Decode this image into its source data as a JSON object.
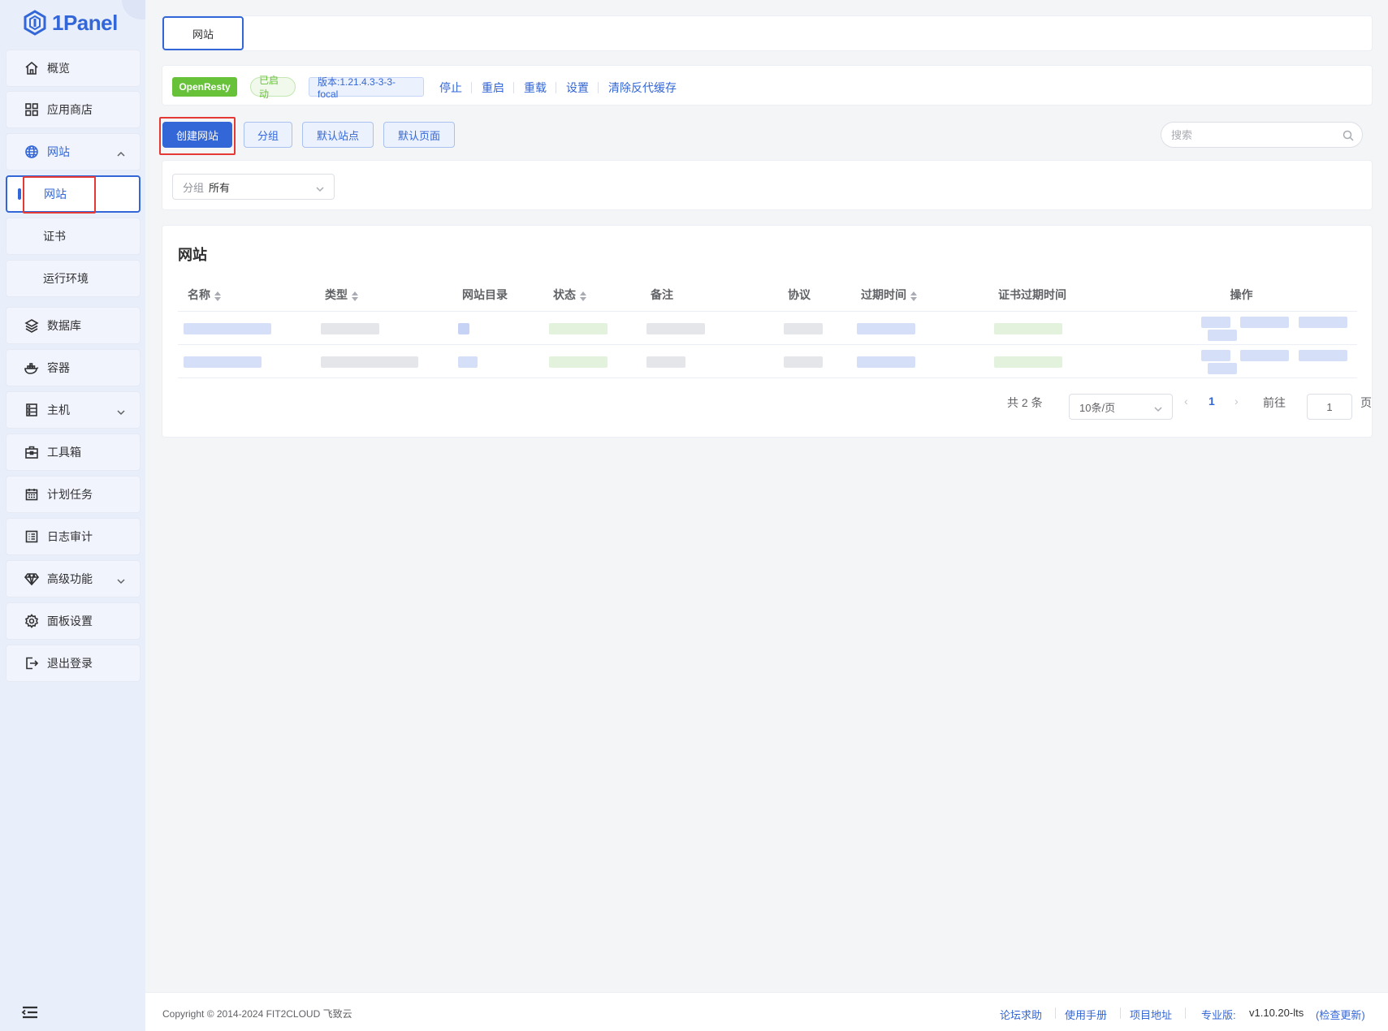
{
  "app": {
    "logo_text": "1Panel"
  },
  "sidebar": {
    "items": [
      {
        "label": "概览",
        "icon": "home-icon"
      },
      {
        "label": "应用商店",
        "icon": "grid-icon"
      },
      {
        "label": "网站",
        "icon": "globe-icon"
      },
      {
        "label": "网站"
      },
      {
        "label": "证书"
      },
      {
        "label": "运行环境"
      },
      {
        "label": "数据库",
        "icon": "layers-icon"
      },
      {
        "label": "容器",
        "icon": "docker-icon"
      },
      {
        "label": "主机",
        "icon": "server-icon"
      },
      {
        "label": "工具箱",
        "icon": "toolbox-icon"
      },
      {
        "label": "计划任务",
        "icon": "calendar-icon"
      },
      {
        "label": "日志审计",
        "icon": "list-icon"
      },
      {
        "label": "高级功能",
        "icon": "diamond-icon"
      },
      {
        "label": "面板设置",
        "icon": "gear-icon"
      },
      {
        "label": "退出登录",
        "icon": "logout-icon"
      }
    ]
  },
  "header": {
    "tab_label": "网站"
  },
  "status_bar": {
    "app_name": "OpenResty",
    "status": "已启动",
    "version": "版本:1.21.4.3-3-3-focal",
    "actions": [
      "停止",
      "重启",
      "重载",
      "设置",
      "清除反代缓存"
    ]
  },
  "toolbar": {
    "create_label": "创建网站",
    "group_label": "分组",
    "default_site_label": "默认站点",
    "default_page_label": "默认页面",
    "search_placeholder": "搜索"
  },
  "filter": {
    "prefix": "分组",
    "value": "所有"
  },
  "table": {
    "title": "网站",
    "columns": [
      "名称",
      "类型",
      "网站目录",
      "状态",
      "备注",
      "协议",
      "过期时间",
      "证书过期时间",
      "操作"
    ]
  },
  "pagination": {
    "total": "共 2 条",
    "page_size": "10条/页",
    "current_page": "1",
    "goto_label": "前往",
    "goto_value": "1",
    "page_unit": "页"
  },
  "footer": {
    "copyright": "Copyright © 2014-2024 FIT2CLOUD 飞致云",
    "links": [
      "论坛求助",
      "使用手册",
      "项目地址"
    ],
    "edition": "专业版:",
    "version": "v1.10.20-lts",
    "check_update": "(检查更新)"
  },
  "colors": {
    "accent": "#3366d6",
    "success": "#67c23a",
    "highlight": "#e53935"
  }
}
